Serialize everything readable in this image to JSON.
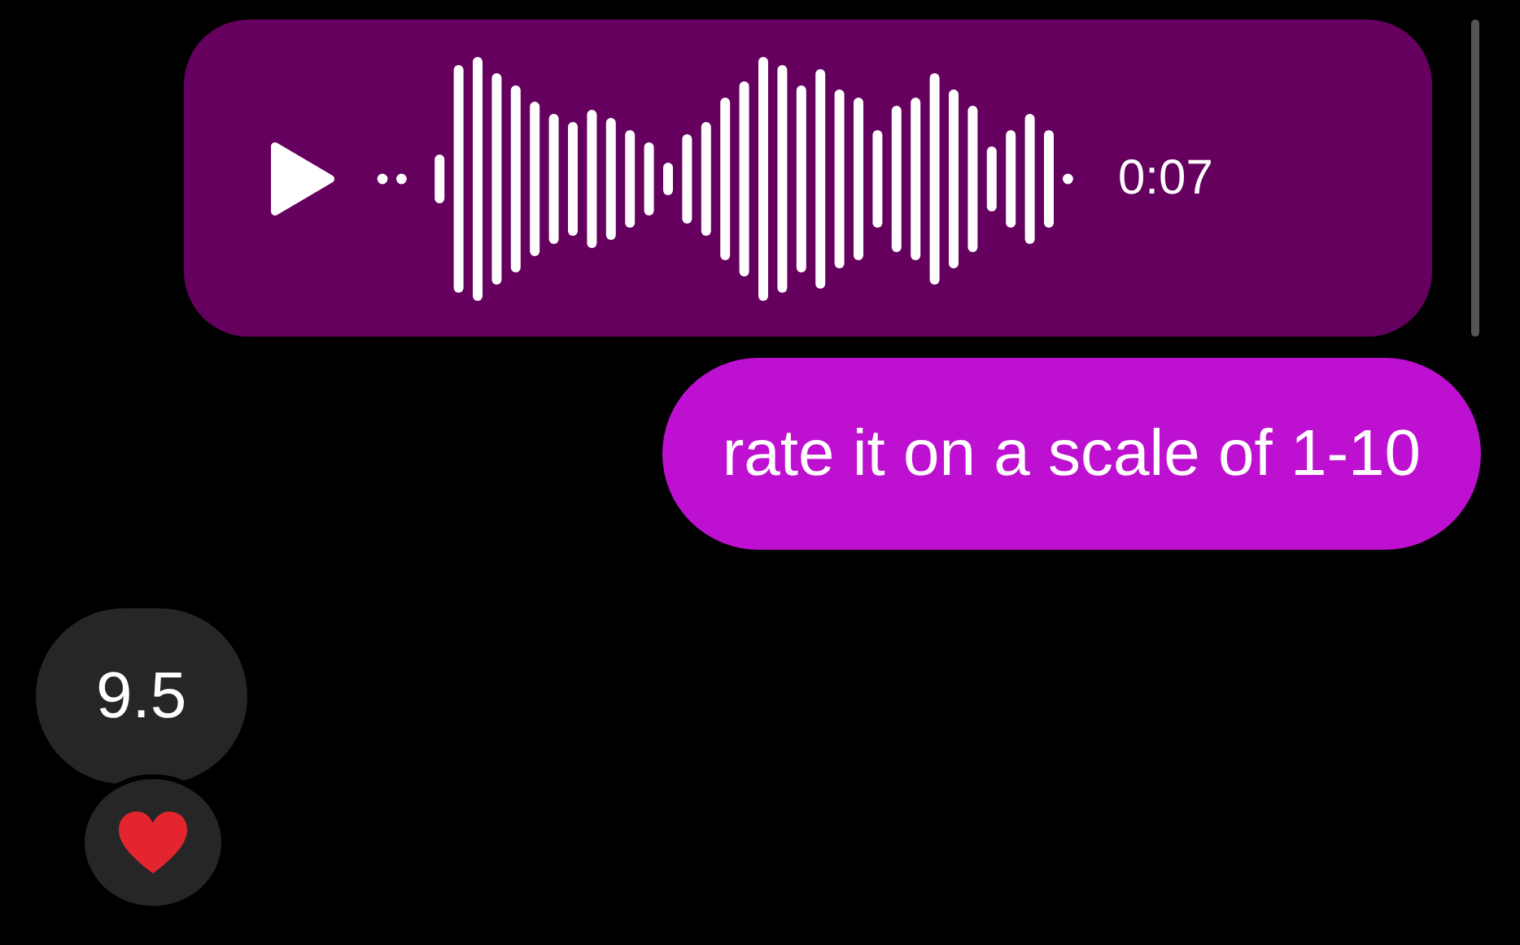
{
  "messages": [
    {
      "kind": "voice",
      "outgoing": true,
      "duration": "0:07"
    },
    {
      "kind": "text",
      "outgoing": true,
      "text": "rate it on a scale of 1-10"
    },
    {
      "kind": "text",
      "outgoing": false,
      "text": "9.5",
      "reaction": {
        "kind": "heart"
      }
    }
  ]
}
